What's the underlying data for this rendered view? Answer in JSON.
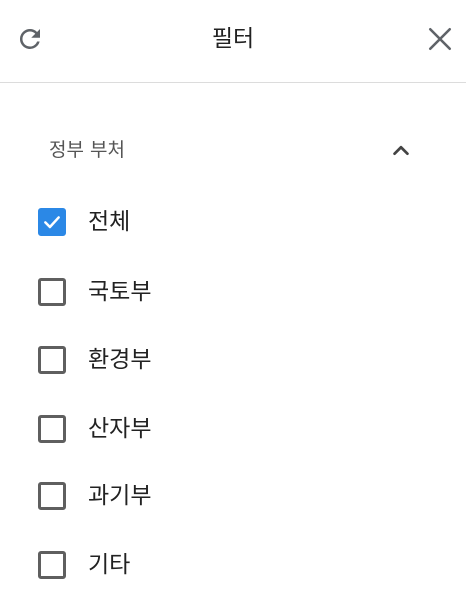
{
  "header": {
    "title": "필터",
    "refresh_icon": "refresh-icon",
    "close_icon": "close-icon"
  },
  "section": {
    "label": "정부 부처",
    "toggle_icon": "chevron-up-icon"
  },
  "options": [
    {
      "label": "전체",
      "checked": true
    },
    {
      "label": "국토부",
      "checked": false
    },
    {
      "label": "환경부",
      "checked": false
    },
    {
      "label": "산자부",
      "checked": false
    },
    {
      "label": "과기부",
      "checked": false
    },
    {
      "label": "기타",
      "checked": false
    }
  ],
  "colors": {
    "accent": "#2b88e6",
    "checkbox_border": "#5f5f5f",
    "divider": "#dcdcdc"
  }
}
